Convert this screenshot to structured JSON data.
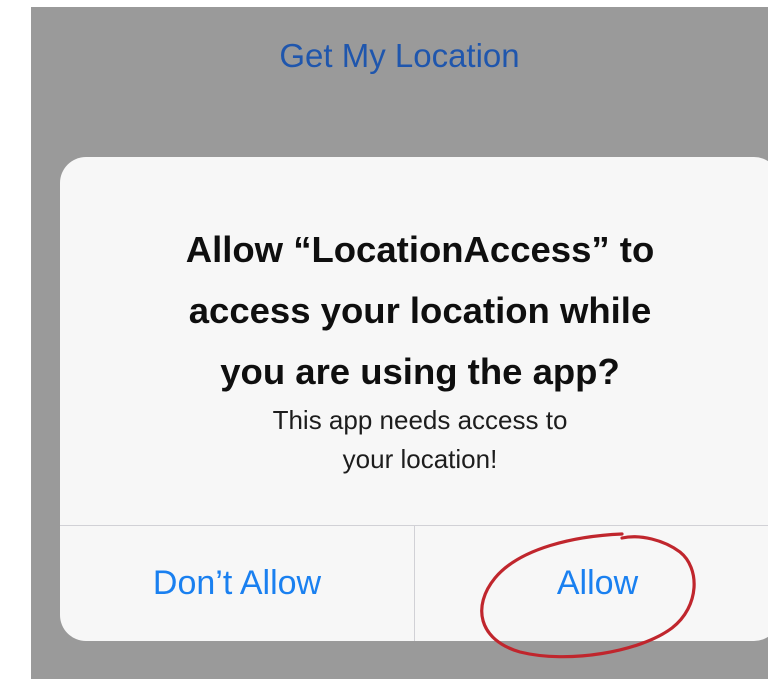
{
  "screen": {
    "get_location_label": "Get My Location"
  },
  "alert": {
    "title_line1": "Allow “LocationAccess” to",
    "title_line2": "access your location while",
    "title_line3": "you are using the app?",
    "message_line1": "This app needs access to",
    "message_line2": "your location!",
    "deny_label": "Don’t Allow",
    "allow_label": "Allow"
  },
  "colors": {
    "backdrop": "#9a9a9a",
    "link_blue": "#1f56ad",
    "button_blue": "#1a80f0",
    "annotation_red": "#c0262d"
  },
  "annotation": {
    "shape": "red-circle-around-allow-button"
  }
}
